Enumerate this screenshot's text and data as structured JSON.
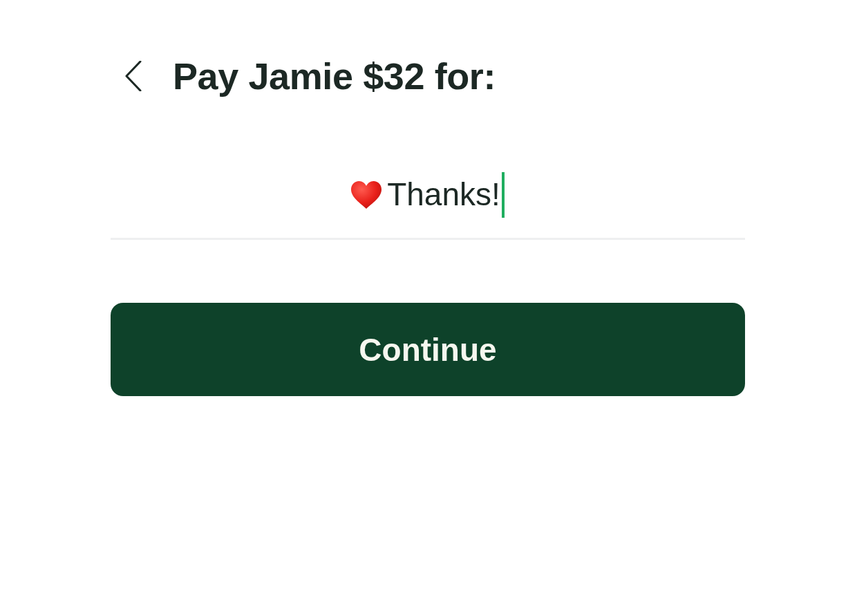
{
  "header": {
    "title": "Pay Jamie $32 for:"
  },
  "message_field": {
    "value": "Thanks!",
    "focused": true
  },
  "buttons": [
    {
      "label": "Continue",
      "kind": "primary"
    }
  ]
}
